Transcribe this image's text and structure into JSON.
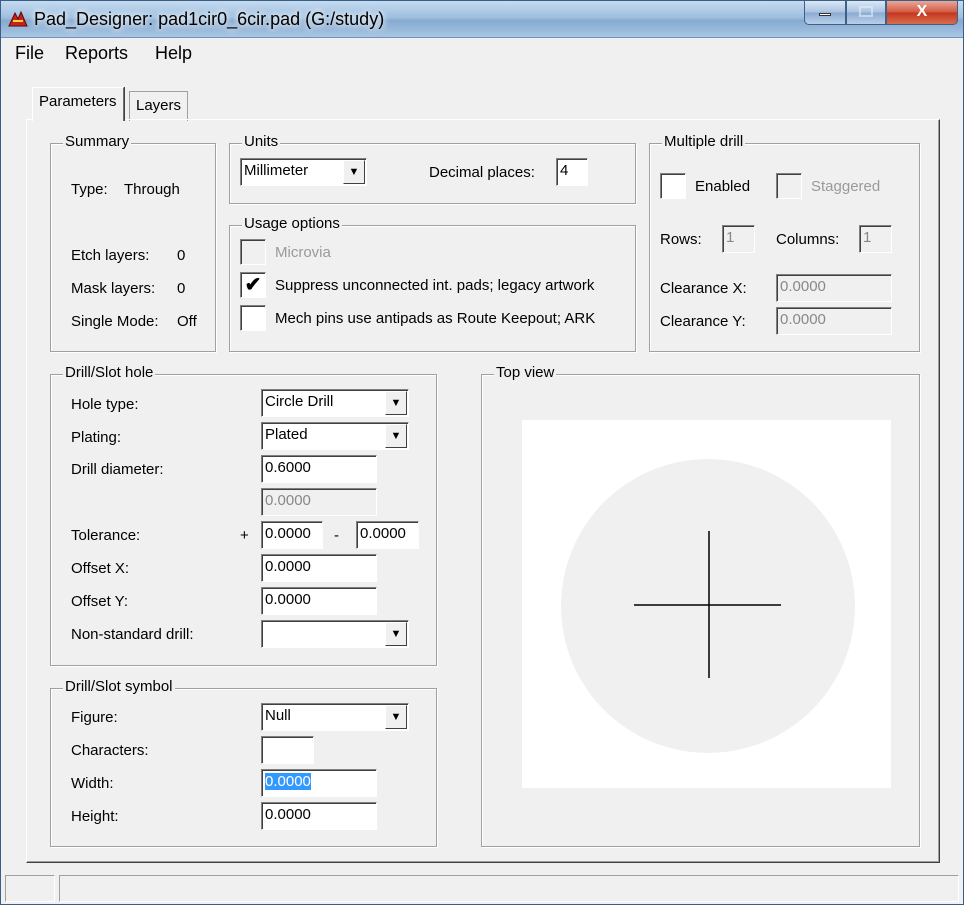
{
  "window": {
    "title": "Pad_Designer: pad1cir0_6cir.pad (G:/study)",
    "close_glyph": "X"
  },
  "menu": [
    "File",
    "Reports",
    "Help"
  ],
  "tabs": [
    "Parameters",
    "Layers"
  ],
  "summary": {
    "title": "Summary",
    "type_label": "Type:",
    "type_value": "Through",
    "etch_label": "Etch layers:",
    "etch_value": "0",
    "mask_label": "Mask layers:",
    "mask_value": "0",
    "single_label": "Single Mode:",
    "single_value": "Off"
  },
  "units": {
    "title": "Units",
    "unit_value": "Millimeter",
    "decimal_label": "Decimal places:",
    "decimal_value": "4"
  },
  "usage": {
    "title": "Usage options",
    "microvia": "Microvia",
    "suppress": "Suppress unconnected int. pads; legacy artwork",
    "mech": "Mech pins use antipads as Route Keepout; ARK",
    "check_mark": "✔"
  },
  "multiple_drill": {
    "title": "Multiple drill",
    "enabled": "Enabled",
    "staggered": "Staggered",
    "rows_label": "Rows:",
    "rows_value": "1",
    "columns_label": "Columns:",
    "columns_value": "1",
    "clearance_x_label": "Clearance X:",
    "clearance_x_value": "0.0000",
    "clearance_y_label": "Clearance Y:",
    "clearance_y_value": "0.0000"
  },
  "drill_hole": {
    "title": "Drill/Slot hole",
    "hole_type_label": "Hole type:",
    "hole_type_value": "Circle Drill",
    "plating_label": "Plating:",
    "plating_value": "Plated",
    "diameter_label": "Drill diameter:",
    "diameter_value": "0.6000",
    "diameter2_value": "0.0000",
    "tolerance_label": "Tolerance:",
    "tol_plus_sign": "+",
    "tol_plus_value": "0.0000",
    "tol_minus_sign": "-",
    "tol_minus_value": "0.0000",
    "offset_x_label": "Offset X:",
    "offset_x_value": "0.0000",
    "offset_y_label": "Offset Y:",
    "offset_y_value": "0.0000",
    "nonstd_label": "Non-standard drill:",
    "nonstd_value": ""
  },
  "drill_symbol": {
    "title": "Drill/Slot symbol",
    "figure_label": "Figure:",
    "figure_value": "Null",
    "characters_label": "Characters:",
    "characters_value": "",
    "width_label": "Width:",
    "width_value": "0.0000",
    "height_label": "Height:",
    "height_value": "0.0000"
  },
  "top_view": {
    "title": "Top view",
    "pad_color": "#f0f0f0",
    "crosshair_color": "#000000"
  },
  "dropdown_glyph": "▼"
}
